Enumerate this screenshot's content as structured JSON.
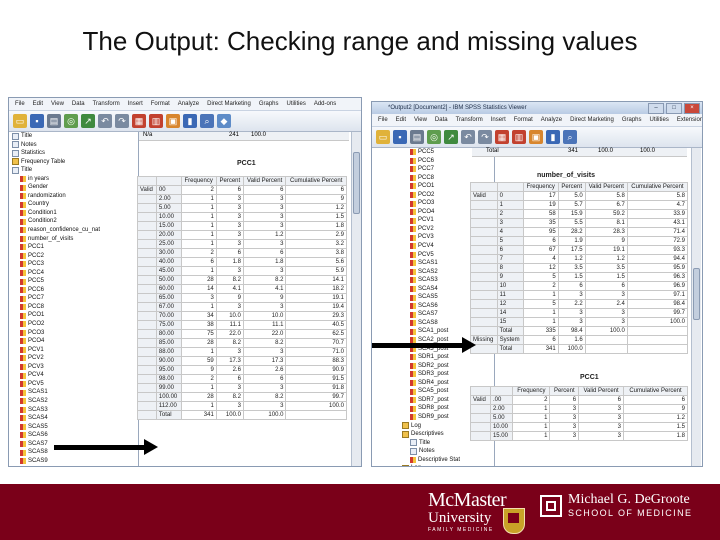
{
  "slide": {
    "title": "The Output: Checking range and missing values"
  },
  "left_window": {
    "menu": [
      "File",
      "Edit",
      "View",
      "Data",
      "Transform",
      "Insert",
      "Format",
      "Analyze",
      "Direct Marketing",
      "Graphs",
      "Utilities",
      "Add-ons"
    ],
    "tree_items": [
      "Title",
      "Notes",
      "Statistics",
      "Frequency Table",
      "Title",
      "in years",
      "Gender",
      "randomization",
      "Country",
      "Condition1",
      "Condition2",
      "reason_confidence_cu_nat",
      "number_of_visits",
      "PCC1",
      "PCC2",
      "PCC3",
      "PCC4",
      "PCC5",
      "PCC6",
      "PCC7",
      "PCC8",
      "PCO1",
      "PCO2",
      "PCO3",
      "PCO4",
      "PCV1",
      "PCV2",
      "PCV3",
      "PCV4",
      "PCV5",
      "SCAS1",
      "SCAS2",
      "SCAS3",
      "SCAS4",
      "SCAS5",
      "SCAS6",
      "SCAS7",
      "SCAS8",
      "SCAS9",
      "SCAS1",
      "SCA2_post",
      "SCA3_post",
      "SCA4_post"
    ],
    "top_strip": {
      "label": "N/a",
      "c1": "241",
      "c2": "100.0"
    },
    "table": {
      "title": "PCC1",
      "headers": [
        "",
        "",
        "Frequency",
        "Percent",
        "Valid Percent",
        "Cumulative Percent"
      ],
      "group_label": "Valid",
      "rows": [
        [
          "00",
          "2",
          "6",
          "6",
          "6"
        ],
        [
          "2.00",
          "1",
          "3",
          "3",
          "9"
        ],
        [
          "5.00",
          "1",
          "3",
          "3",
          "1.2"
        ],
        [
          "10.00",
          "1",
          "3",
          "3",
          "1.5"
        ],
        [
          "15.00",
          "1",
          "3",
          "3",
          "1.8"
        ],
        [
          "20.00",
          "1",
          "3",
          "1.2",
          "2.9"
        ],
        [
          "25.00",
          "1",
          "3",
          "3",
          "3.2"
        ],
        [
          "30.00",
          "2",
          "6",
          "6",
          "3.8"
        ],
        [
          "40.00",
          "6",
          "1.8",
          "1.8",
          "5.6"
        ],
        [
          "45.00",
          "1",
          "3",
          "3",
          "5.9"
        ],
        [
          "50.00",
          "28",
          "8.2",
          "8.2",
          "14.1"
        ],
        [
          "60.00",
          "14",
          "4.1",
          "4.1",
          "18.2"
        ],
        [
          "65.00",
          "3",
          "9",
          "9",
          "19.1"
        ],
        [
          "67.00",
          "1",
          "3",
          "3",
          "19.4"
        ],
        [
          "70.00",
          "34",
          "10.0",
          "10.0",
          "29.3"
        ],
        [
          "75.00",
          "38",
          "11.1",
          "11.1",
          "40.5"
        ],
        [
          "80.00",
          "75",
          "22.0",
          "22.0",
          "62.5"
        ],
        [
          "85.00",
          "28",
          "8.2",
          "8.2",
          "70.7"
        ],
        [
          "88.00",
          "1",
          "3",
          "3",
          "71.0"
        ],
        [
          "90.00",
          "59",
          "17.3",
          "17.3",
          "88.3"
        ],
        [
          "95.00",
          "9",
          "2.6",
          "2.6",
          "90.9"
        ],
        [
          "98.00",
          "2",
          "6",
          "6",
          "91.5"
        ],
        [
          "99.00",
          "1",
          "3",
          "3",
          "91.8"
        ],
        [
          "100.00",
          "28",
          "8.2",
          "8.2",
          "99.7"
        ],
        [
          "112.00",
          "1",
          "3",
          "3",
          "100.0"
        ],
        [
          "Total",
          "341",
          "100.0",
          "100.0",
          ""
        ]
      ]
    }
  },
  "right_window": {
    "title": "*Output2 [Document2] - IBM SPSS Statistics Viewer",
    "menu": [
      "File",
      "Edit",
      "View",
      "Data",
      "Transform",
      "Insert",
      "Format",
      "Analyze",
      "Direct Marketing",
      "Graphs",
      "Utilities",
      "Extensions",
      "Window"
    ],
    "tree_items": [
      "PCC5",
      "PCC6",
      "PCC7",
      "PCC8",
      "PCO1",
      "PCO2",
      "PCO3",
      "PCO4",
      "PCV1",
      "PCV2",
      "PCV3",
      "PCV4",
      "PCV5",
      "SCAS1",
      "SCAS2",
      "SCAS3",
      "SCAS4",
      "SCAS5",
      "SCAS6",
      "SCAS7",
      "SCAS8",
      "SCA1_post",
      "SCA2_post",
      "SCA3_post",
      "SDR1_post",
      "SDR2_post",
      "SDR3_post",
      "SDR4_post",
      "SCA5_post",
      "SDR7_post",
      "SDR8_post",
      "SDR9_post",
      "Log",
      "Descriptives",
      "Title",
      "Notes",
      "Descriptive Stat",
      "Log",
      "Descriptives",
      "Title",
      "Descriptive Stat"
    ],
    "top_strip": {
      "label": "Total",
      "c1": "341",
      "c2": "100.0",
      "c3": "100.0"
    },
    "visits_table": {
      "title": "number_of_visits",
      "headers": [
        "",
        "",
        "Frequency",
        "Percent",
        "Valid Percent",
        "Cumulative Percent"
      ],
      "group_label": "Valid",
      "rows": [
        [
          "0",
          "17",
          "5.0",
          "5.8",
          "5.8"
        ],
        [
          "1",
          "19",
          "5.7",
          "6.7",
          "4.7"
        ],
        [
          "2",
          "58",
          "15.9",
          "59.2",
          "33.9"
        ],
        [
          "3",
          "35",
          "5.5",
          "8.1",
          "43.1"
        ],
        [
          "4",
          "95",
          "28.2",
          "28.3",
          "71.4"
        ],
        [
          "5",
          "6",
          "1.9",
          "9",
          "72.9"
        ],
        [
          "6",
          "67",
          "17.5",
          "19.1",
          "93.3"
        ],
        [
          "7",
          "4",
          "1.2",
          "1.2",
          "94.4"
        ],
        [
          "8",
          "12",
          "3.5",
          "3.5",
          "95.9"
        ],
        [
          "9",
          "5",
          "1.5",
          "1.5",
          "96.3"
        ],
        [
          "10",
          "2",
          "6",
          "6",
          "96.9"
        ],
        [
          "11",
          "1",
          "3",
          "3",
          "97.1"
        ],
        [
          "12",
          "5",
          "2.2",
          "2.4",
          "98.4"
        ],
        [
          "14",
          "1",
          "3",
          "3",
          "99.7"
        ],
        [
          "15",
          "1",
          "3",
          "3",
          "100.0"
        ],
        [
          "Total",
          "335",
          "98.4",
          "100.0",
          ""
        ]
      ],
      "missing_label": "Missing",
      "missing_row": [
        "System",
        "6",
        "1.6",
        "",
        ""
      ],
      "total_row": [
        "Total",
        "341",
        "100.0",
        "",
        ""
      ]
    },
    "pcc1_table": {
      "title": "PCC1",
      "headers": [
        "",
        "",
        "Frequency",
        "Percent",
        "Valid Percent",
        "Cumulative Percent"
      ],
      "group_label": "Valid",
      "rows": [
        [
          ".00",
          "2",
          "6",
          "6",
          "6"
        ],
        [
          "2.00",
          "1",
          "3",
          "3",
          "9"
        ],
        [
          "5.00",
          "1",
          "3",
          "3",
          "1.2"
        ],
        [
          "10.00",
          "1",
          "3",
          "3",
          "1.5"
        ],
        [
          "15.00",
          "1",
          "3",
          "3",
          "1.8"
        ]
      ]
    }
  },
  "footer": {
    "brand1_line1": "McMaster",
    "brand1_line2": "University",
    "brand1_line3": "FAMILY MEDICINE",
    "brand2_line1": "Michael G. DeGroote",
    "brand2_line2": "SCHOOL OF MEDICINE"
  },
  "colors": {
    "footer_bg": "#7a0019",
    "arrow": "#000000"
  }
}
